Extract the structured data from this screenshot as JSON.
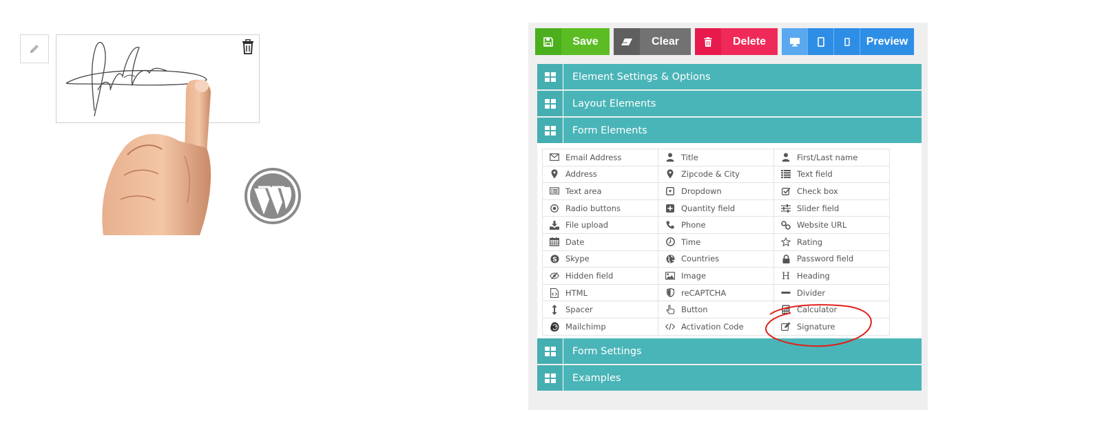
{
  "toolbar": {
    "save_label": "Save",
    "clear_label": "Clear",
    "delete_label": "Delete",
    "preview_label": "Preview"
  },
  "accordions": {
    "element_settings": "Element Settings & Options",
    "layout_elements": "Layout Elements",
    "form_elements": "Form Elements",
    "form_settings": "Form Settings",
    "examples": "Examples"
  },
  "elements": [
    {
      "label": "Email Address",
      "icon": "envelope-icon"
    },
    {
      "label": "Title",
      "icon": "user-icon"
    },
    {
      "label": "First/Last name",
      "icon": "user-icon"
    },
    {
      "label": "Address",
      "icon": "map-marker-icon"
    },
    {
      "label": "Zipcode & City",
      "icon": "map-marker-icon"
    },
    {
      "label": "Text field",
      "icon": "list-icon"
    },
    {
      "label": "Text area",
      "icon": "textarea-icon"
    },
    {
      "label": "Dropdown",
      "icon": "caret-square-icon"
    },
    {
      "label": "Check box",
      "icon": "check-square-icon"
    },
    {
      "label": "Radio buttons",
      "icon": "radio-icon"
    },
    {
      "label": "Quantity field",
      "icon": "plus-square-icon"
    },
    {
      "label": "Slider field",
      "icon": "sliders-icon"
    },
    {
      "label": "File upload",
      "icon": "download-icon"
    },
    {
      "label": "Phone",
      "icon": "phone-icon"
    },
    {
      "label": "Website URL",
      "icon": "link-icon"
    },
    {
      "label": "Date",
      "icon": "calendar-icon"
    },
    {
      "label": "Time",
      "icon": "clock-icon"
    },
    {
      "label": "Rating",
      "icon": "star-icon"
    },
    {
      "label": "Skype",
      "icon": "skype-icon"
    },
    {
      "label": "Countries",
      "icon": "globe-icon"
    },
    {
      "label": "Password field",
      "icon": "lock-icon"
    },
    {
      "label": "Hidden field",
      "icon": "eye-slash-icon"
    },
    {
      "label": "Image",
      "icon": "picture-icon"
    },
    {
      "label": "Heading",
      "icon": "heading-icon"
    },
    {
      "label": "HTML",
      "icon": "code-file-icon"
    },
    {
      "label": "reCAPTCHA",
      "icon": "shield-icon"
    },
    {
      "label": "Divider",
      "icon": "minus-icon"
    },
    {
      "label": "Spacer",
      "icon": "arrows-vertical-icon"
    },
    {
      "label": "Button",
      "icon": "hand-pointer-icon"
    },
    {
      "label": "Calculator",
      "icon": "calculator-icon"
    },
    {
      "label": "Mailchimp",
      "icon": "mailchimp-icon"
    },
    {
      "label": "Activation Code",
      "icon": "code-icon"
    },
    {
      "label": "Signature",
      "icon": "edit-icon"
    }
  ],
  "colors": {
    "accordion": "#4ab5b8",
    "save": "#5bbd23",
    "clear": "#727272",
    "delete": "#ef2a58",
    "preview": "#2e8ee6",
    "annotation": "#e0201b"
  }
}
